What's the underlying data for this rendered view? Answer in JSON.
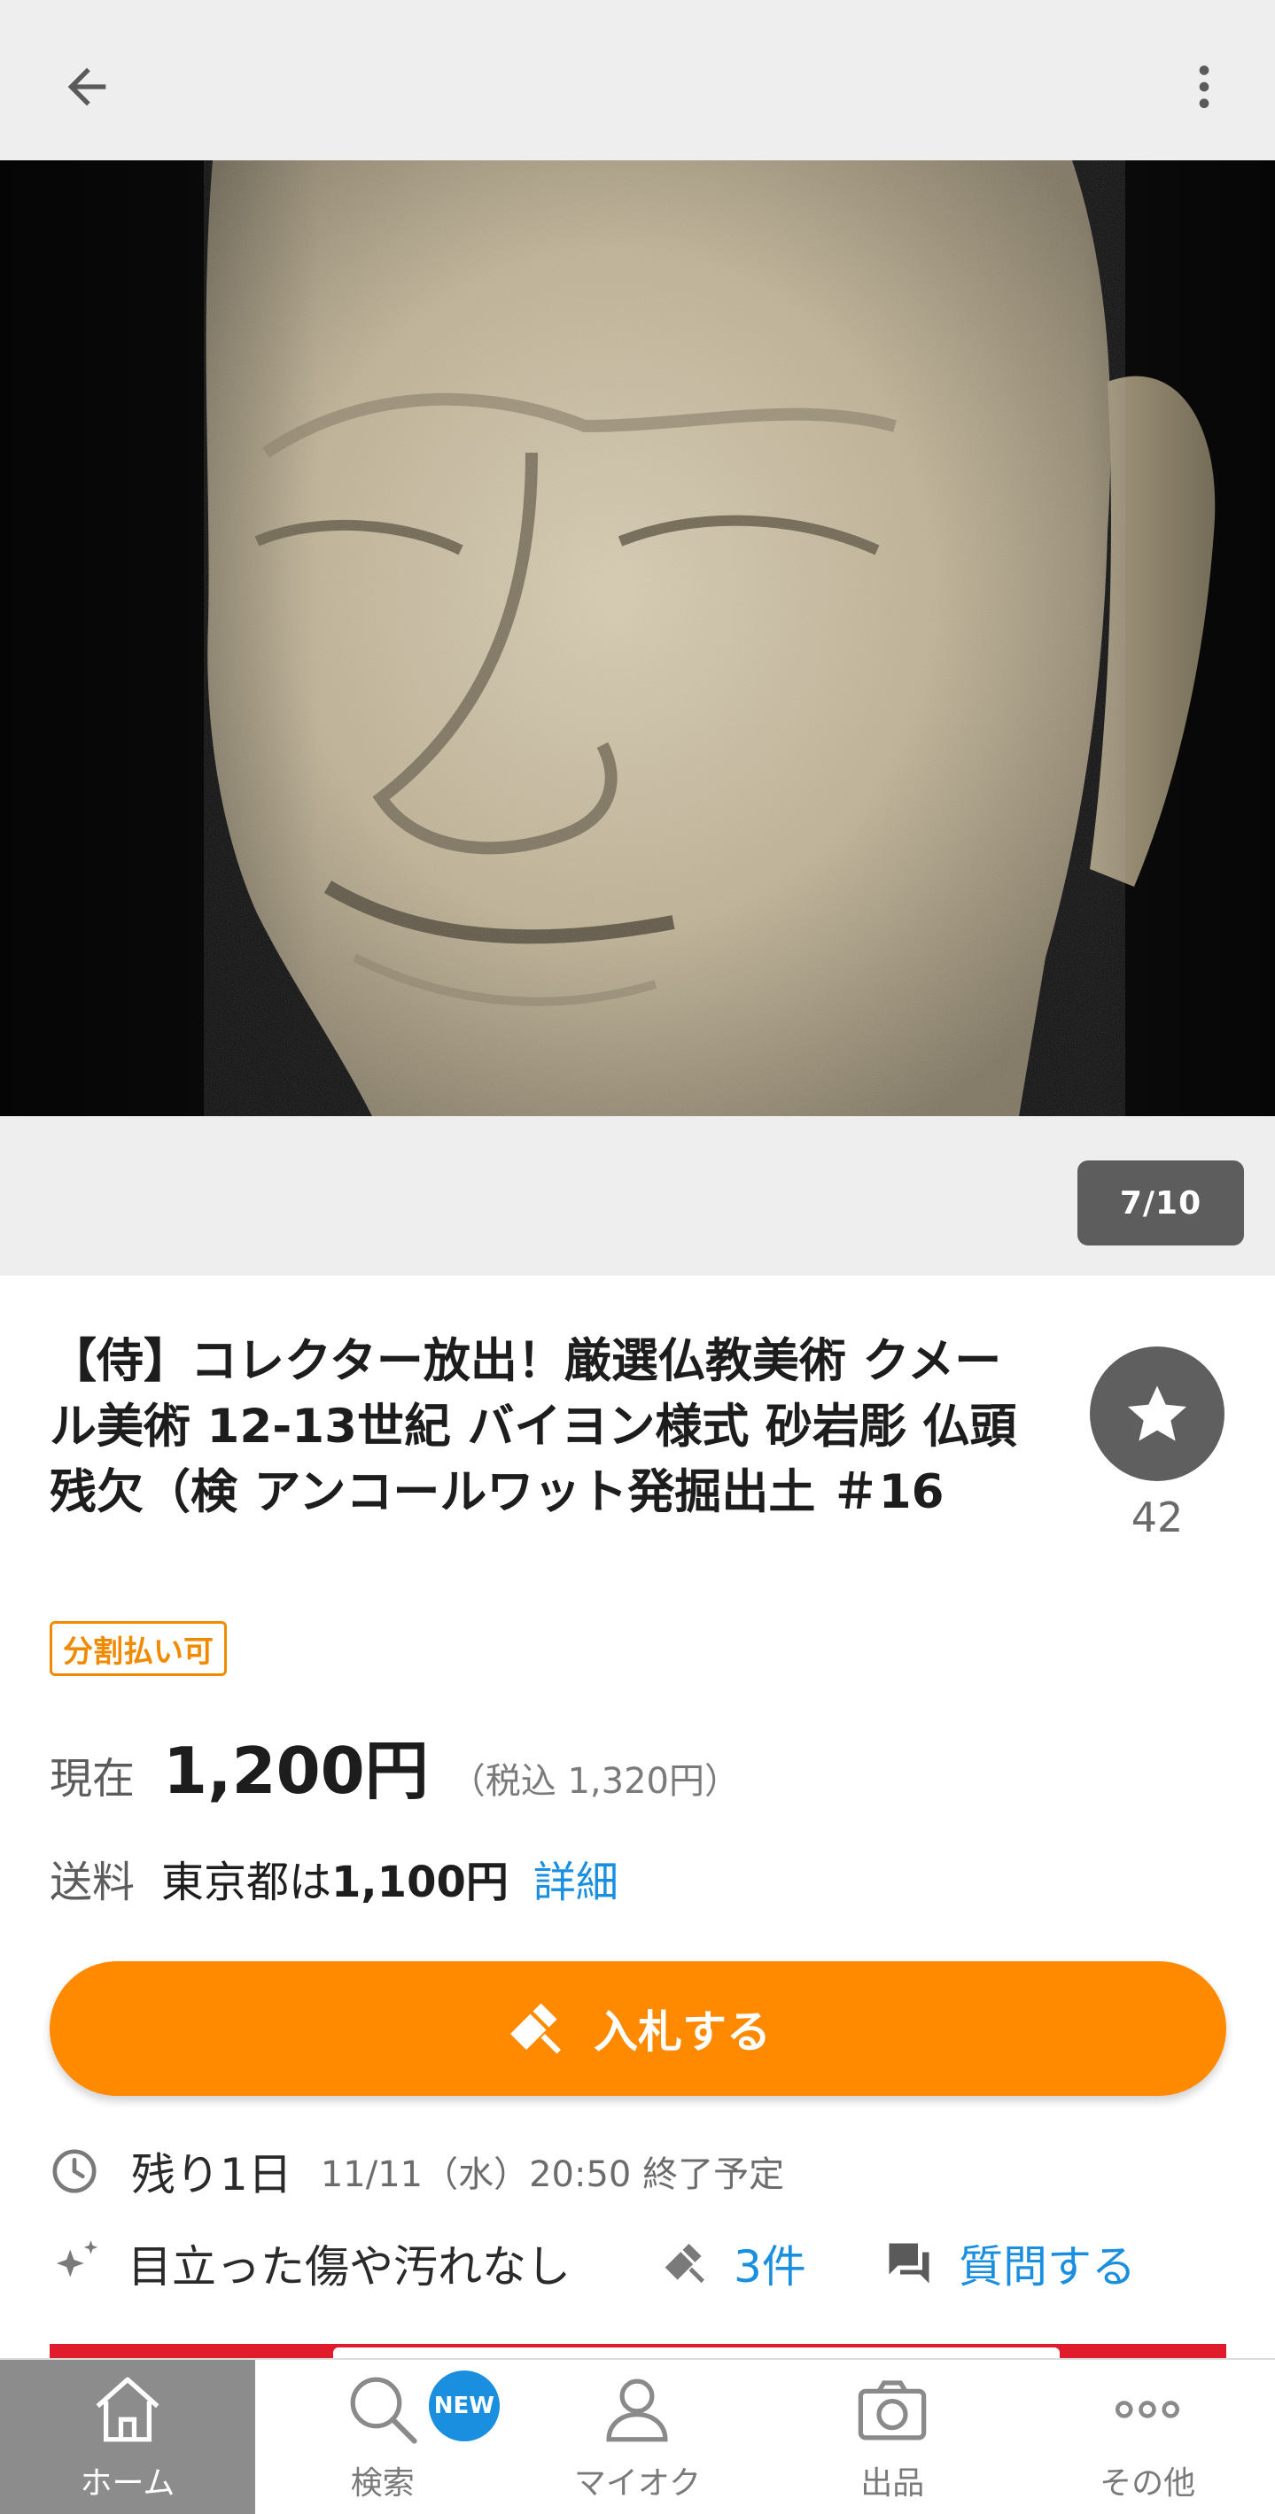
{
  "header": {
    "back_icon": "arrow-left-icon",
    "menu_icon": "more-vertical-icon"
  },
  "gallery": {
    "counter": "7/10"
  },
  "item": {
    "title": "【侍】コレクター放出！厳選仏教美術 クメール美術 12-13世紀 バイヨン様式 砂岩彫 仏頭残欠（検 アンコールワット発掘出土 ＃16",
    "watch_count": "42",
    "badge": "分割払い可",
    "price_label": "現在",
    "price_value": "1,200円",
    "price_tax": "（税込 1,320円）",
    "shipping_label": "送料",
    "shipping_prefix": "東京都は",
    "shipping_value": "1,100円",
    "shipping_detail": "詳細"
  },
  "actions": {
    "bid_label": "入札する"
  },
  "status": {
    "remaining_label": "残り1日",
    "end_time": "11/11（水）20:50 終了予定",
    "condition": "目立った傷や汚れなし",
    "bids": "3件",
    "question": "質問する"
  },
  "nav": {
    "items": [
      {
        "label": "ホーム",
        "icon": "home-icon"
      },
      {
        "label": "検索",
        "icon": "search-icon",
        "badge": "NEW"
      },
      {
        "label": "マイオク",
        "icon": "person-icon"
      },
      {
        "label": "出品",
        "icon": "camera-icon"
      },
      {
        "label": "その他",
        "icon": "more-horizontal-icon"
      }
    ]
  },
  "colors": {
    "accent_orange": "#ff8a00",
    "link_blue": "#1a8fe0",
    "active_nav": "#8c8c8c"
  }
}
